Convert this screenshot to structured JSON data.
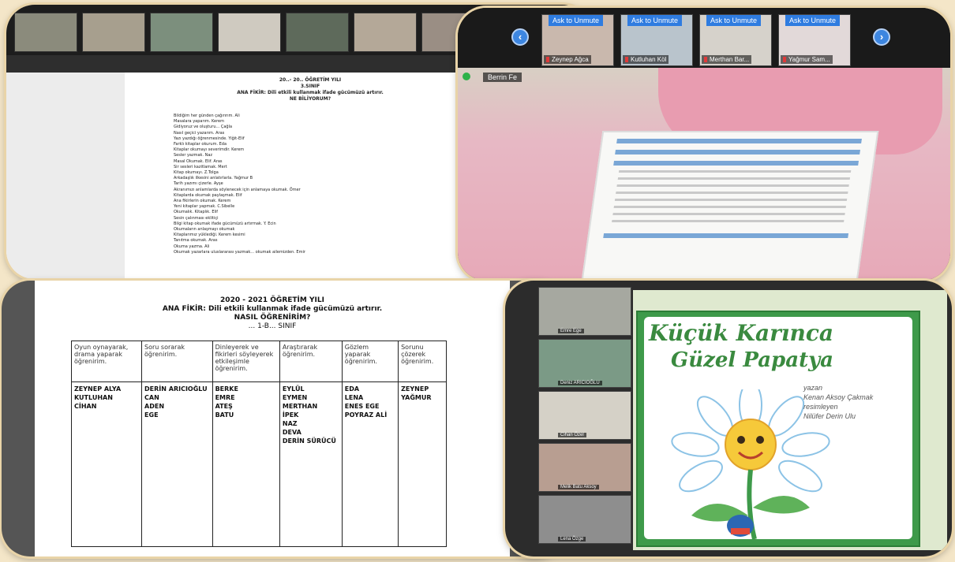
{
  "panel_top_left": {
    "thumbnails": [
      "",
      "",
      "",
      "",
      "",
      "",
      "",
      ""
    ],
    "doc_title": "20..- 20.. ÖĞRETİM YILI",
    "doc_grade": "3.SINIF",
    "doc_idea": "ANA FİKİR: Dili etkili kullanmak ifade gücümüzü artırır.",
    "doc_question": "NE BİLİYORUM?",
    "doc_lines": [
      "Bildiğim her günden çağırırım. Ali",
      "Masalara yaparım. Kerem",
      "Gidiyoruz ve oluşturu... Çağla",
      "Nasıl geçici yazarım. Aras",
      "Yazı yazdığı öğrenmesinde. Yiğit-Elif",
      "Farklı kitaplar okurum. Eda",
      "Kitaplar okumayı severimdir. Kerem",
      "Sesler yazmak. Naz",
      "Masal Okumak. Elif. Aras",
      "Sir sesleri kazitlamak. Mert",
      "Kitap okumayı. Z.Tolga",
      "Arkadaşlık ilkesini anlatırlarla. Yağmur B",
      "Tarih yazımı çizerle. Ayşe",
      "Akranımızı anlamlarda söylenecek için anlamaya okumak. Ömer",
      "Kitaplarda okumak paylaşmak. Elif",
      "Ana fikirlerin okumak. Kerem",
      "Yeni kitaplar yapmak. C.Sibelle",
      "Okumalık. Kitaplık. Elif",
      "Sesin çalınması eklitiçi",
      "Bilgi kitap okumak ifade gücümüzü artırmak. Y. Ecin",
      "Okumaların anlaşmayı okumak",
      "Kitaplarımız yüklediği. Kerem kesimi",
      "Tanıtma okumak. Aras",
      "Okuma yazma. Ali",
      "Okumak yazarlara uluslararası yazmak... okumak ailemizden. Emir"
    ]
  },
  "panel_top_right": {
    "unmute_label": "Ask to Unmute",
    "participants": [
      "Zeynep Ağca",
      "Kutluhan Köl",
      "Merthan Bar...",
      "Yağmur Sam..."
    ],
    "active_speaker": "Berrin Fe"
  },
  "panel_bottom_left": {
    "title": "2020 - 2021 ÖĞRETİM YILI",
    "idea": "ANA FİKİR: Dili etkili kullanmak ifade gücümüzü artırır.",
    "question": "NASIL ÖĞRENİRİM?",
    "grade": "... 1-B... SINIF",
    "columns": [
      {
        "header": "Oyun oynayarak, drama yaparak öğrenirim.",
        "names": [
          "ZEYNEP ALYA",
          "KUTLUHAN",
          "CİHAN"
        ]
      },
      {
        "header": "Soru sorarak öğrenirim.",
        "names": [
          "DERİN ARICIOĞLU",
          "CAN",
          "ADEN",
          "EGE"
        ]
      },
      {
        "header": "Dinleyerek ve fikirleri söyleyerek etkileşimle öğrenirim.",
        "names": [
          "BERKE",
          "EMRE",
          "ATEŞ",
          "BATU"
        ]
      },
      {
        "header": "Araştırarak öğrenirim.",
        "names": [
          "EYLÜL",
          "EYMEN",
          "MERTHAN",
          "İPEK",
          "NAZ",
          "DEVA",
          "DERİN SÜRÜCÜ"
        ]
      },
      {
        "header": "Gözlem yaparak öğrenirim.",
        "names": [
          "EDA",
          "LENA",
          "ENES EGE",
          "POYRAZ ALİ"
        ]
      },
      {
        "header": "Sorunu çözerek öğrenirim.",
        "names": [
          "ZEYNEP",
          "YAĞMUR"
        ]
      }
    ]
  },
  "panel_bottom_right": {
    "thumbs": [
      "Emre Ege",
      "Deniz ARICIOĞLU",
      "Cihan Özel",
      "Melik Batu Aksoy",
      "Lena Özge"
    ],
    "book_title_1": "Küçük Karınca",
    "book_title_2": "Güzel Papatya",
    "author": "Kenan Aksoy Çakmak",
    "author_role": "yazan",
    "illustrator": "Nilüfer Derin Ulu",
    "illustrator_role": "resimleyen"
  },
  "colors": {
    "background": "#f4e6c8",
    "zoom_blue": "#2f7ce0",
    "book_green": "#3e9a4a"
  }
}
